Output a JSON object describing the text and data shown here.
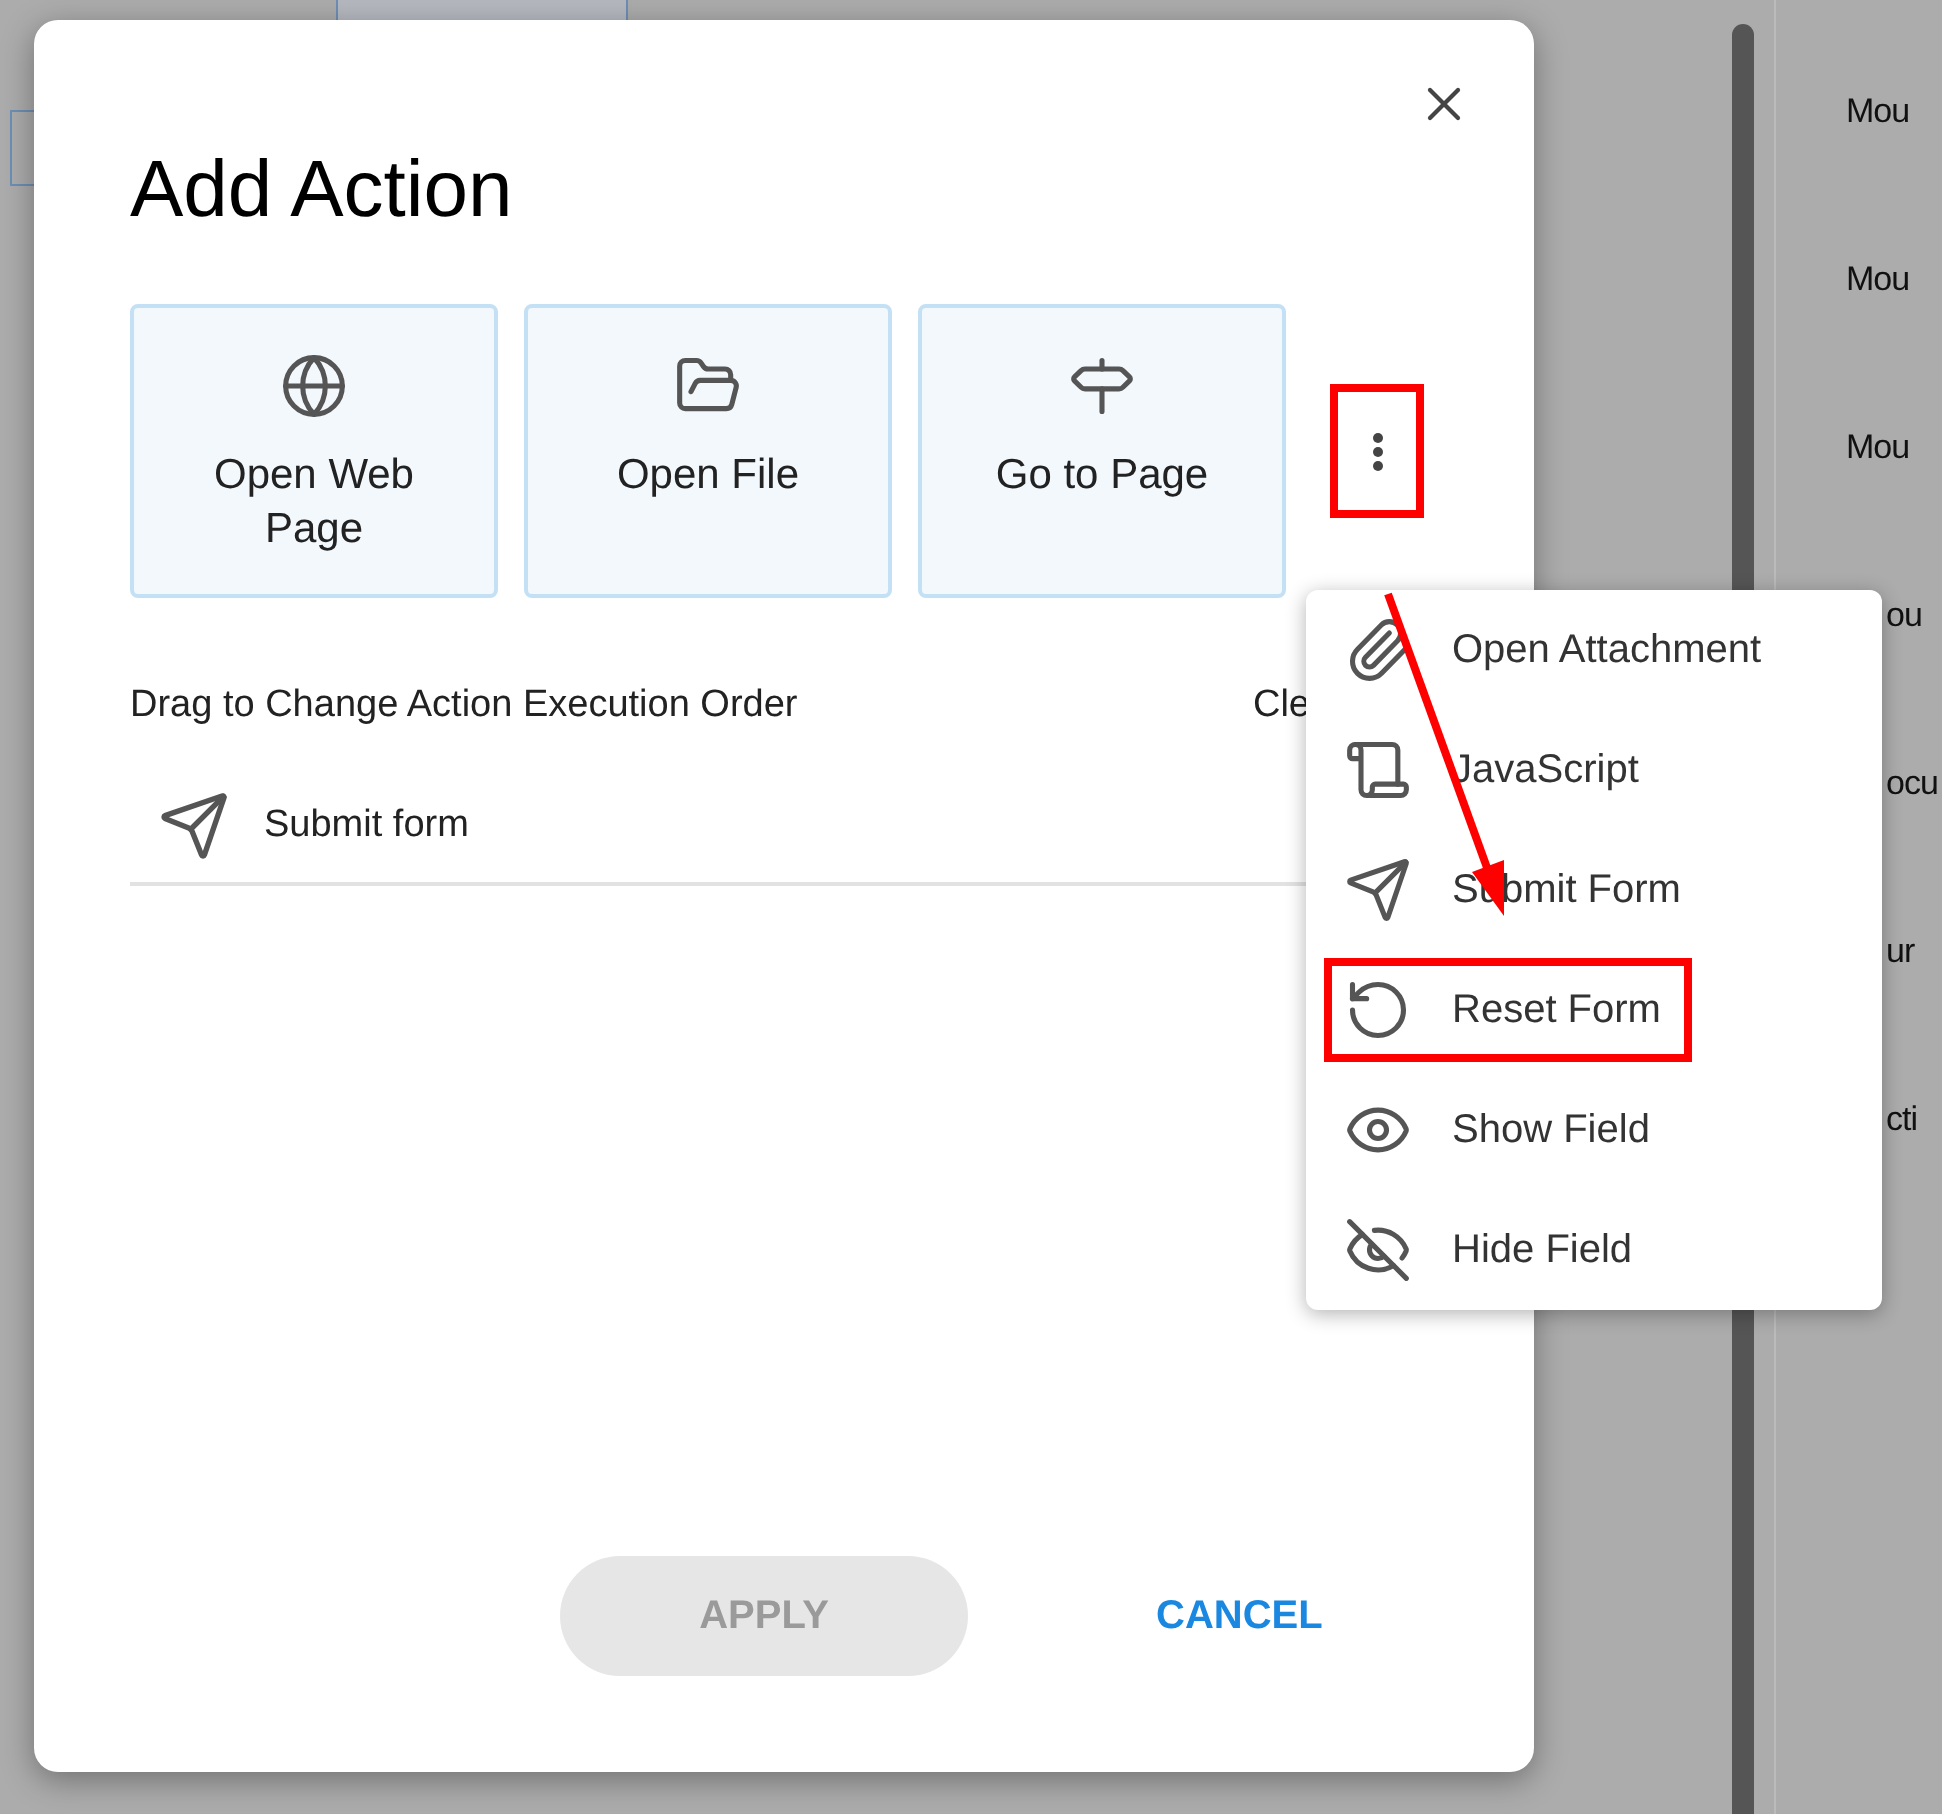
{
  "background": {
    "side_items": [
      "Mou",
      "Mou",
      "Mou",
      "ou",
      "ocu",
      "ur",
      "cti"
    ]
  },
  "dialog": {
    "title": "Add Action",
    "action_cards": [
      {
        "label": "Open Web Page",
        "kind": "globe"
      },
      {
        "label": "Open File",
        "kind": "folder"
      },
      {
        "label": "Go to Page",
        "kind": "signpost"
      }
    ],
    "more_button": {
      "highlighted": true
    },
    "list_heading": "Drag to Change Action Execution Order",
    "list_action": "Cle",
    "actions": [
      {
        "label": "Submit form",
        "kind": "send"
      }
    ],
    "buttons": [
      {
        "label": "APPLY",
        "kind": "filled",
        "disabled": true
      },
      {
        "label": "CANCEL",
        "kind": "text",
        "disabled": false
      }
    ]
  },
  "menu": {
    "items": [
      {
        "label": "Open Attachment",
        "kind": "paperclip",
        "highlighted": false
      },
      {
        "label": "JavaScript",
        "kind": "scroll",
        "highlighted": false
      },
      {
        "label": "Submit Form",
        "kind": "send",
        "highlighted": false
      },
      {
        "label": "Reset Form",
        "kind": "reset",
        "highlighted": true
      },
      {
        "label": "Show Field",
        "kind": "eye",
        "highlighted": false
      },
      {
        "label": "Hide Field",
        "kind": "eye-off",
        "highlighted": false
      }
    ]
  }
}
